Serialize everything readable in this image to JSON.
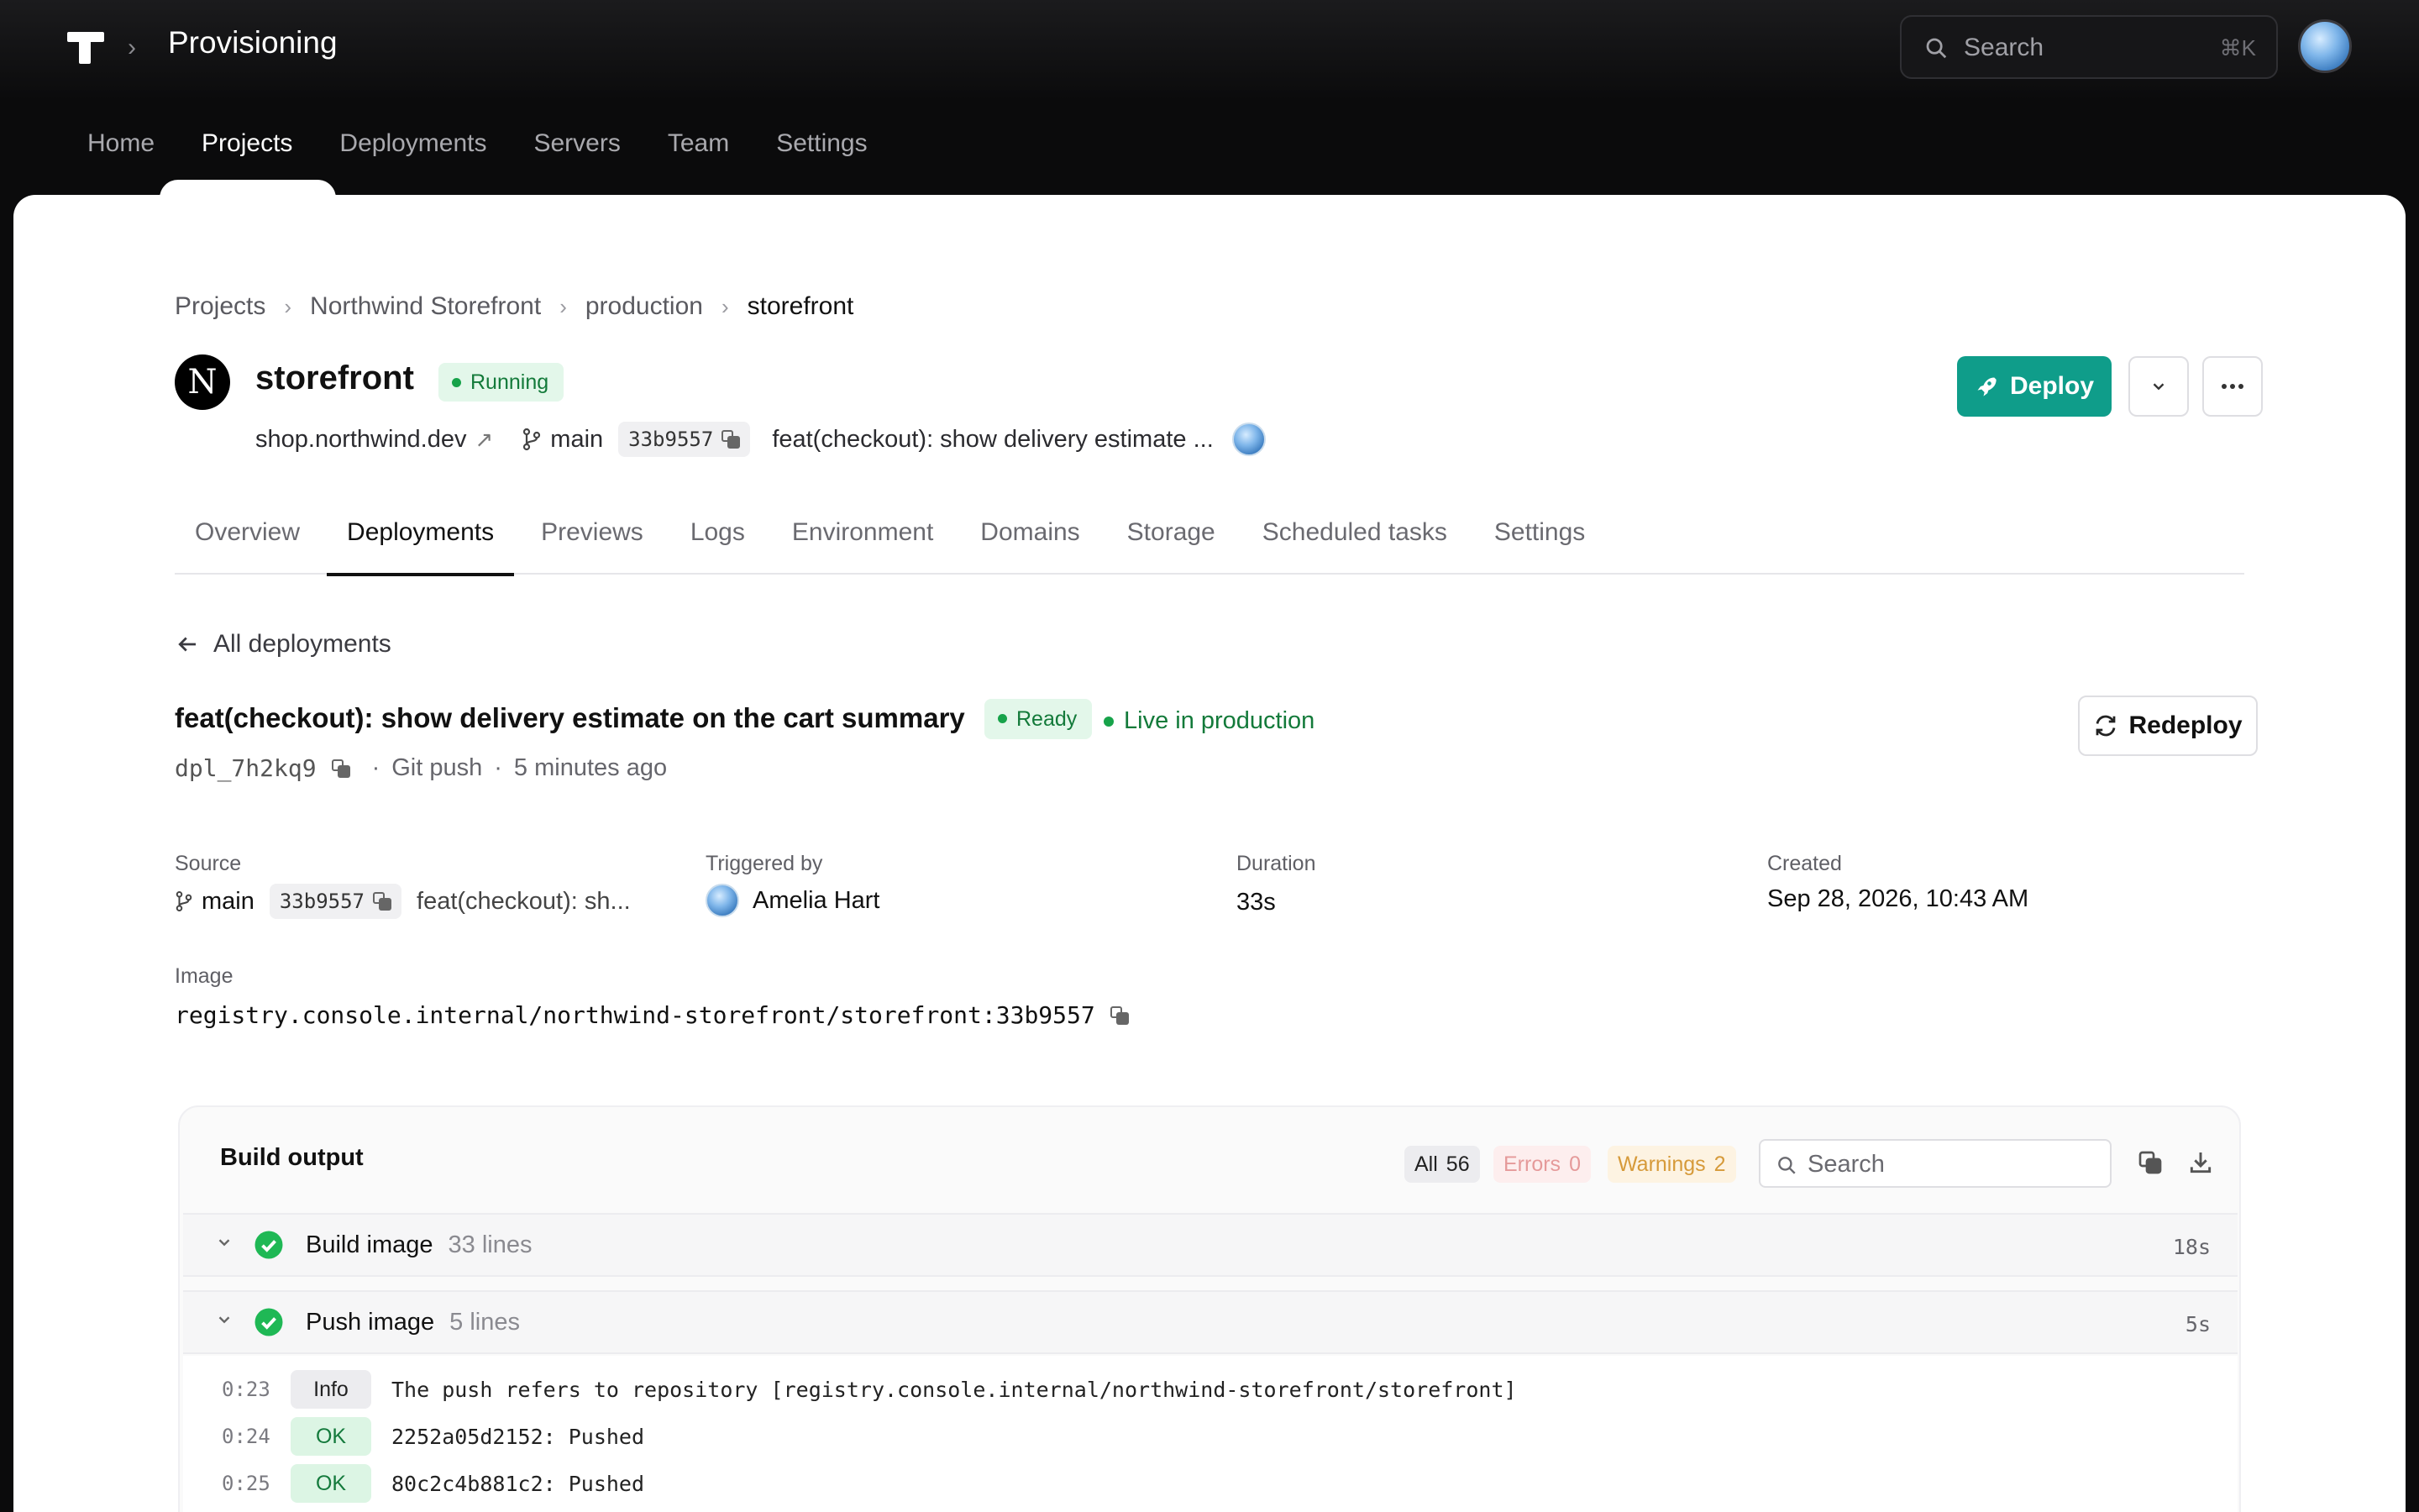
{
  "topbar": {
    "app_title": "Provisioning",
    "search_placeholder": "Search",
    "search_shortcut": "⌘K"
  },
  "topnav": [
    "Home",
    "Projects",
    "Deployments",
    "Servers",
    "Team",
    "Settings"
  ],
  "topnav_active": "Projects",
  "breadcrumb": [
    "Projects",
    "Northwind Storefront",
    "production",
    "storefront"
  ],
  "project": {
    "logo_letter": "N",
    "name": "storefront",
    "status": "Running",
    "domain": "shop.northwind.dev",
    "branch": "main",
    "sha": "33b9557",
    "commit_message": "feat(checkout): show delivery estimate ..."
  },
  "actions": {
    "deploy_label": "Deploy"
  },
  "tabs": [
    "Overview",
    "Deployments",
    "Previews",
    "Logs",
    "Environment",
    "Domains",
    "Storage",
    "Scheduled tasks",
    "Settings"
  ],
  "tabs_active": "Deployments",
  "deployment": {
    "back_label": "All deployments",
    "title": "feat(checkout): show delivery estimate on the cart summary",
    "status": "Ready",
    "live_label": "Live in production",
    "id": "dpl_7h2kq9",
    "trigger_type": "Git push",
    "age": "5 minutes ago",
    "redeploy_label": "Redeploy",
    "info": {
      "source_label": "Source",
      "source_branch": "main",
      "source_sha": "33b9557",
      "source_message": "feat(checkout): sh...",
      "triggered_label": "Triggered by",
      "triggered_by": "Amelia Hart",
      "duration_label": "Duration",
      "duration": "33s",
      "created_label": "Created",
      "created": "Sep 28, 2026, 10:43 AM",
      "image_label": "Image",
      "image": "registry.console.internal/northwind-storefront/storefront:33b9557"
    }
  },
  "build_output": {
    "title": "Build output",
    "filters": {
      "all_label": "All",
      "all_count": "56",
      "errors_label": "Errors",
      "errors_count": "0",
      "warnings_label": "Warnings",
      "warnings_count": "2"
    },
    "search_placeholder": "Search",
    "steps": [
      {
        "name": "Build image",
        "lines": "33 lines",
        "duration": "18s"
      },
      {
        "name": "Push image",
        "lines": "5 lines",
        "duration": "5s"
      }
    ],
    "logs": [
      {
        "time": "0:23",
        "level": "Info",
        "message": "The push refers to repository [registry.console.internal/northwind-storefront/storefront]"
      },
      {
        "time": "0:24",
        "level": "OK",
        "message": "2252a05d2152: Pushed"
      },
      {
        "time": "0:25",
        "level": "OK",
        "message": "80c2c4b881c2: Pushed"
      }
    ]
  },
  "colors": {
    "accent": "#0f9d8a",
    "success": "#17a34a",
    "topbar": "#0b0b0c"
  },
  "icons": [
    "search-icon",
    "avatar",
    "external-link-icon",
    "git-branch-icon",
    "copy-icon",
    "rocket-icon",
    "chevron-down-icon",
    "more-icon",
    "arrow-left-icon",
    "refresh-icon",
    "check-circle-icon",
    "download-icon"
  ]
}
